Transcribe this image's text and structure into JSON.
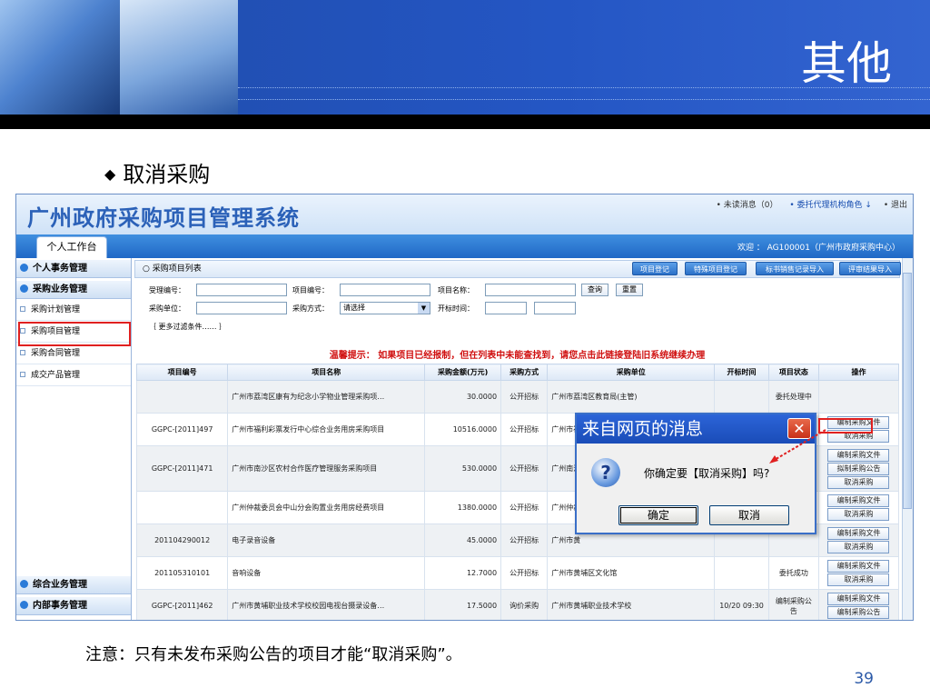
{
  "slide": {
    "title": "其他",
    "bullet": "取消采购",
    "note": "注意：只有未发布采购公告的项目才能“取消采购”。",
    "page": "39"
  },
  "system": {
    "title": "广州政府采购项目管理系统",
    "links": [
      "• 未读消息（0）",
      "• 委托代理机构角色 ↓",
      "• 退出"
    ],
    "tab": "个人工作台",
    "welcome": "欢迎 ： AG100001（广州市政府采购中心）"
  },
  "sidebar": {
    "groups": [
      "个人事务管理",
      "采购业务管理",
      "综合业务管理",
      "内部事务管理"
    ],
    "items": [
      "采购计划管理",
      "采购项目管理",
      "采购合同管理",
      "成交产品管理"
    ]
  },
  "main": {
    "list_title": "采购项目列表",
    "toolbar": [
      "项目登记",
      "特殊项目登记",
      "标书销售记录导入",
      "评审结果导入"
    ],
    "filters": {
      "accept_no": "受理编号：",
      "project_no": "项目编号：",
      "project_name": "项目名称：",
      "unit": "采购单位：",
      "method": "采购方式：",
      "method_value": "请选择",
      "open_time": "开标时间：",
      "query": "查询",
      "reset": "重置",
      "more": "｛ 更多过滤条件…… ｝"
    },
    "tip": "温馨提示： 如果项目已经报制，但在列表中未能查找到，请您点击此链接登陆旧系统继续办理",
    "columns": [
      "项目编号",
      "项目名称",
      "采购金额(万元)",
      "采购方式",
      "采购单位",
      "开标时间",
      "项目状态",
      "操作"
    ],
    "rows": [
      {
        "no": "",
        "name": "广州市荔湾区康有为纪念小学物业管理采购项…",
        "amount": "30.0000",
        "method": "公开招标",
        "unit": "广州市荔湾区教育局(主管)",
        "time": "",
        "status": "委托处理中",
        "ops": []
      },
      {
        "no": "GGPC-[2011]497",
        "name": "广州市福利彩票发行中心综合业务用房采购项目",
        "amount": "10516.0000",
        "method": "公开招标",
        "unit": "广州市福",
        "time": "",
        "status": "",
        "ops": [
          "编制采购文件",
          "取消采购"
        ]
      },
      {
        "no": "GGPC-[2011]471",
        "name": "广州市南沙区农村合作医疗管理服务采购项目",
        "amount": "530.0000",
        "method": "公开招标",
        "unit": "广州南沙",
        "time": "",
        "status": "",
        "ops": [
          "编制采购文件",
          "拟制采购公告",
          "取消采购"
        ]
      },
      {
        "no": "",
        "name": "广州仲裁委员会中山分会购置业务用房经费项目",
        "amount": "1380.0000",
        "method": "公开招标",
        "unit": "广州仲裁",
        "time": "",
        "status": "",
        "ops": [
          "编制采购文件",
          "取消采购"
        ]
      },
      {
        "no": "201104290012",
        "name": "电子录音设备",
        "amount": "45.0000",
        "method": "公开招标",
        "unit": "广州市黄",
        "time": "",
        "status": "",
        "ops": [
          "编制采购文件",
          "取消采购"
        ]
      },
      {
        "no": "201105310101",
        "name": "音响设备",
        "amount": "12.7000",
        "method": "公开招标",
        "unit": "广州市黄埔区文化馆",
        "time": "",
        "status": "委托成功",
        "ops": [
          "编制采购文件",
          "取消采购"
        ]
      },
      {
        "no": "GGPC-[2011]462",
        "name": "广州市黄埔职业技术学校校园电视台摄录设备…",
        "amount": "17.5000",
        "method": "询价采购",
        "unit": "广州市黄埔职业技术学校",
        "time": "10/20 09:30",
        "status": "编制采购公告",
        "ops": [
          "编制采购文件",
          "编制采购公告"
        ]
      }
    ]
  },
  "dialog": {
    "title": "来自网页的消息",
    "icon": "question-icon",
    "message": "你确定要【取消采购】吗?",
    "ok": "确定",
    "cancel": "取消"
  }
}
